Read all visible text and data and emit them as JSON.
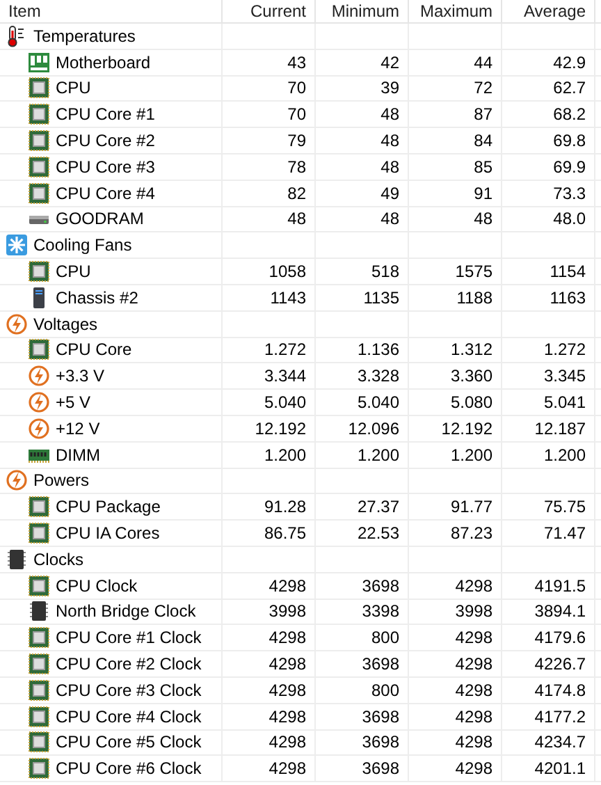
{
  "columns": [
    "Item",
    "Current",
    "Minimum",
    "Maximum",
    "Average"
  ],
  "groups": [
    {
      "label": "Temperatures",
      "kind": "thermometer",
      "items": [
        {
          "label": "Motherboard",
          "kind": "board",
          "values": [
            "43",
            "42",
            "44",
            "42.9"
          ]
        },
        {
          "label": "CPU",
          "kind": "cpu",
          "values": [
            "70",
            "39",
            "72",
            "62.7"
          ]
        },
        {
          "label": "CPU Core #1",
          "kind": "cpu",
          "values": [
            "70",
            "48",
            "87",
            "68.2"
          ]
        },
        {
          "label": "CPU Core #2",
          "kind": "cpu",
          "values": [
            "79",
            "48",
            "84",
            "69.8"
          ]
        },
        {
          "label": "CPU Core #3",
          "kind": "cpu",
          "values": [
            "78",
            "48",
            "85",
            "69.9"
          ]
        },
        {
          "label": "CPU Core #4",
          "kind": "cpu",
          "values": [
            "82",
            "49",
            "91",
            "73.3"
          ]
        },
        {
          "label": "GOODRAM",
          "kind": "drive",
          "values": [
            "48",
            "48",
            "48",
            "48.0"
          ]
        }
      ]
    },
    {
      "label": "Cooling Fans",
      "kind": "fan",
      "items": [
        {
          "label": "CPU",
          "kind": "cpu",
          "values": [
            "1058",
            "518",
            "1575",
            "1154"
          ]
        },
        {
          "label": "Chassis #2",
          "kind": "tower",
          "values": [
            "1143",
            "1135",
            "1188",
            "1163"
          ]
        }
      ]
    },
    {
      "label": "Voltages",
      "kind": "bolt",
      "items": [
        {
          "label": "CPU Core",
          "kind": "cpu",
          "values": [
            "1.272",
            "1.136",
            "1.312",
            "1.272"
          ]
        },
        {
          "label": "+3.3 V",
          "kind": "bolt",
          "values": [
            "3.344",
            "3.328",
            "3.360",
            "3.345"
          ]
        },
        {
          "label": "+5 V",
          "kind": "bolt",
          "values": [
            "5.040",
            "5.040",
            "5.080",
            "5.041"
          ]
        },
        {
          "label": "+12 V",
          "kind": "bolt",
          "values": [
            "12.192",
            "12.096",
            "12.192",
            "12.187"
          ]
        },
        {
          "label": "DIMM",
          "kind": "memory",
          "values": [
            "1.200",
            "1.200",
            "1.200",
            "1.200"
          ]
        }
      ]
    },
    {
      "label": "Powers",
      "kind": "bolt",
      "items": [
        {
          "label": "CPU Package",
          "kind": "cpu",
          "values": [
            "91.28",
            "27.37",
            "91.77",
            "75.75"
          ]
        },
        {
          "label": "CPU IA Cores",
          "kind": "cpu",
          "values": [
            "86.75",
            "22.53",
            "87.23",
            "71.47"
          ]
        }
      ]
    },
    {
      "label": "Clocks",
      "kind": "chip",
      "items": [
        {
          "label": "CPU Clock",
          "kind": "cpu",
          "values": [
            "4298",
            "3698",
            "4298",
            "4191.5"
          ]
        },
        {
          "label": "North Bridge Clock",
          "kind": "chip",
          "values": [
            "3998",
            "3398",
            "3998",
            "3894.1"
          ]
        },
        {
          "label": "CPU Core #1 Clock",
          "kind": "cpu",
          "values": [
            "4298",
            "800",
            "4298",
            "4179.6"
          ]
        },
        {
          "label": "CPU Core #2 Clock",
          "kind": "cpu",
          "values": [
            "4298",
            "3698",
            "4298",
            "4226.7"
          ]
        },
        {
          "label": "CPU Core #3 Clock",
          "kind": "cpu",
          "values": [
            "4298",
            "800",
            "4298",
            "4174.8"
          ]
        },
        {
          "label": "CPU Core #4 Clock",
          "kind": "cpu",
          "values": [
            "4298",
            "3698",
            "4298",
            "4177.2"
          ]
        },
        {
          "label": "CPU Core #5 Clock",
          "kind": "cpu",
          "values": [
            "4298",
            "3698",
            "4298",
            "4234.7"
          ]
        },
        {
          "label": "CPU Core #6 Clock",
          "kind": "cpu",
          "values": [
            "4298",
            "3698",
            "4298",
            "4201.1"
          ]
        }
      ]
    }
  ]
}
